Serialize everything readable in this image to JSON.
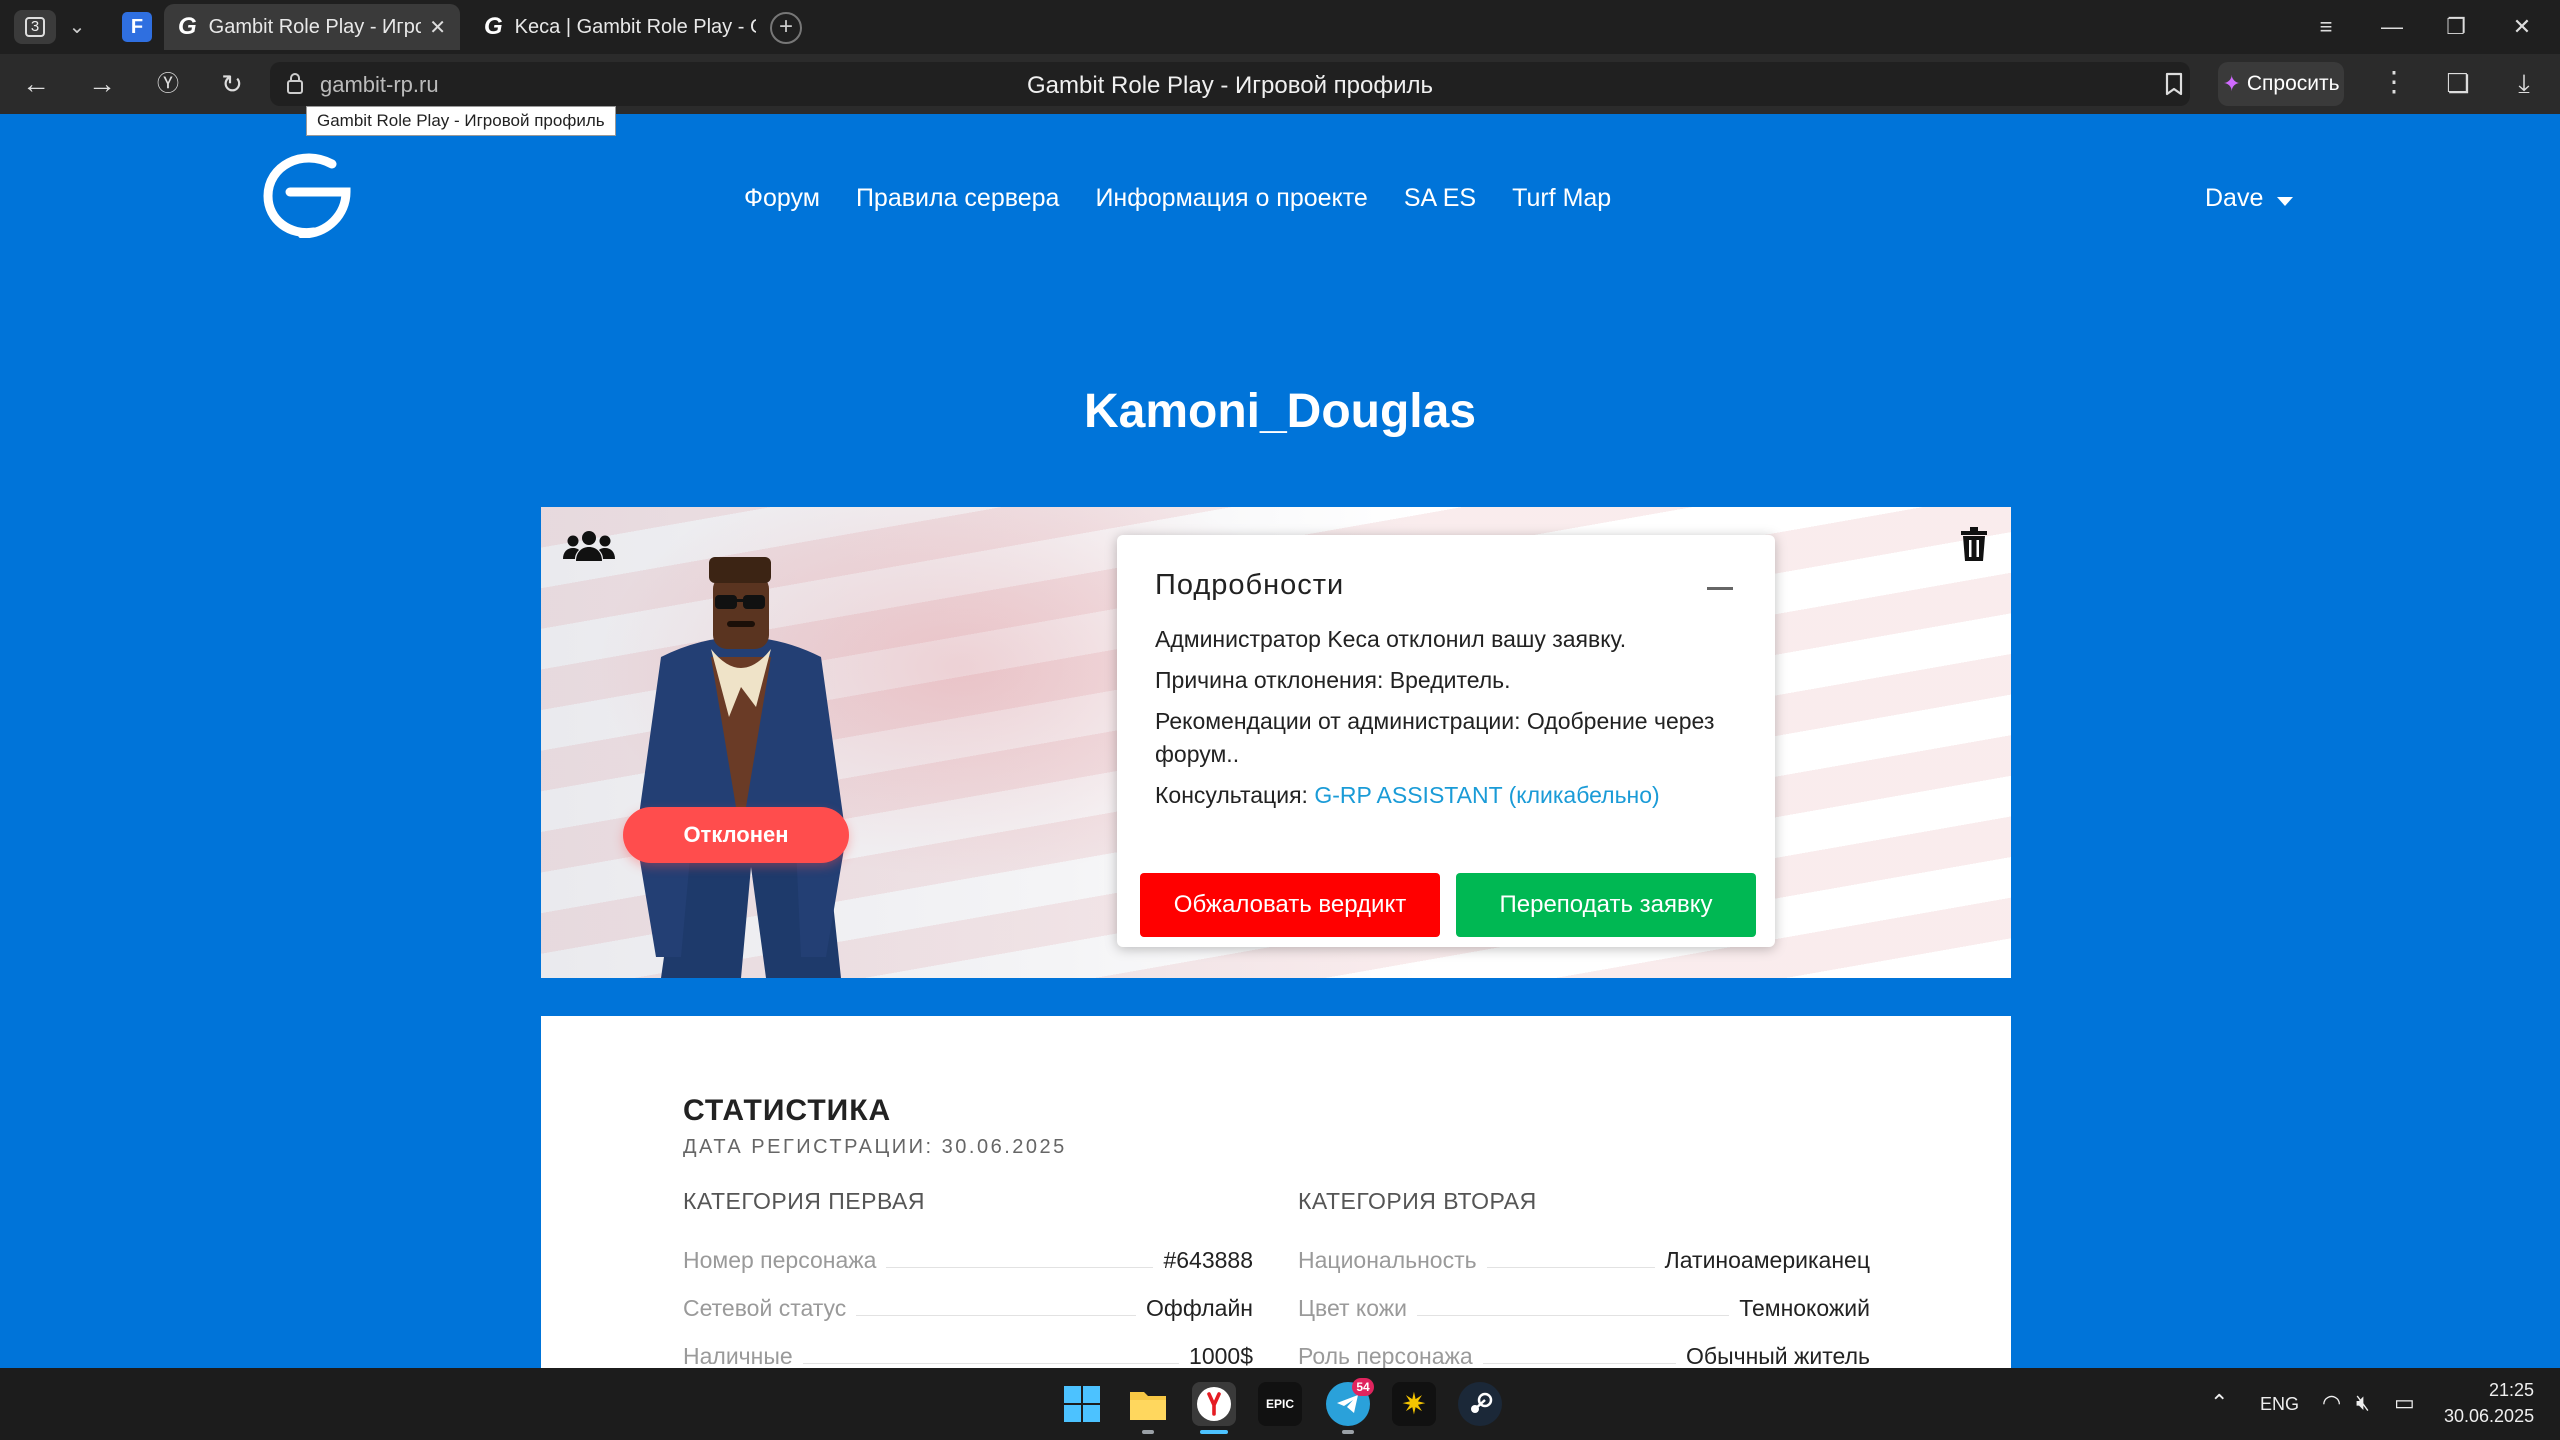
{
  "browser": {
    "tab_count": "3",
    "tabs": [
      {
        "title": "Gambit Role Play - Игровой профиль",
        "active": true
      },
      {
        "title": "Keca | Gambit Role Play - G",
        "active": false
      }
    ],
    "url": "gambit-rp.ru",
    "page_title": "Gambit Role Play - Игровой профиль",
    "tooltip": "Gambit Role Play - Игровой профиль",
    "ask_label": "Спросить"
  },
  "site": {
    "nav": [
      "Форум",
      "Правила сервера",
      "Информация о проекте",
      "SA ES",
      "Turf Map"
    ],
    "user": "Dave"
  },
  "profile": {
    "name": "Kamoni_Douglas",
    "status": "Отклонен",
    "details": {
      "title": "Подробности",
      "line1": "Администратор Keca отклонил вашу заявку.",
      "line2": "Причина отклонения: Вредитель.",
      "line3": "Рекомендации от администрации: Одобрение через форум..",
      "consult_label": "Консультация: ",
      "consult_link": "G-RP ASSISTANT (кликабельно)",
      "appeal_button": "Обжаловать вердикт",
      "resubmit_button": "Переподать заявку"
    }
  },
  "stats": {
    "title": "СТАТИСТИКА",
    "registration": "ДАТА РЕГИСТРАЦИИ: 30.06.2025",
    "category1": {
      "title": "КАТЕГОРИЯ ПЕРВАЯ",
      "rows": [
        {
          "label": "Номер персонажа",
          "value": "#643888"
        },
        {
          "label": "Сетевой статус",
          "value": "Оффлайн"
        },
        {
          "label": "Наличные",
          "value": "1000$"
        }
      ]
    },
    "category2": {
      "title": "КАТЕГОРИЯ ВТОРАЯ",
      "rows": [
        {
          "label": "Национальность",
          "value": "Латиноамериканец"
        },
        {
          "label": "Цвет кожи",
          "value": "Темнокожий"
        },
        {
          "label": "Роль персонажа",
          "value": "Обычный житель"
        }
      ]
    }
  },
  "taskbar": {
    "telegram_badge": "54",
    "epic_label": "EPIC",
    "lang": "ENG",
    "time": "21:25",
    "date": "30.06.2025"
  },
  "colors": {
    "page_bg": "#0074d9",
    "status_rejected": "#ff4d4d",
    "appeal": "#ff0000",
    "resubmit": "#00b853",
    "link": "#1a9bd7"
  }
}
